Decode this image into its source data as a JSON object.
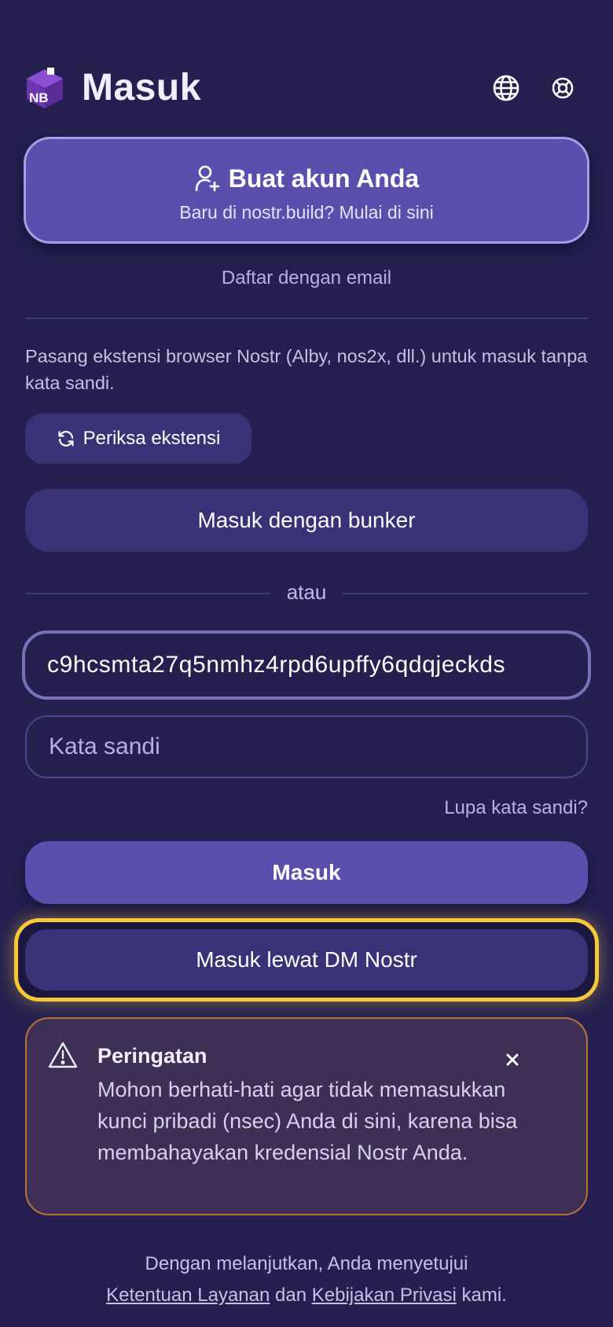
{
  "header": {
    "title": "Masuk",
    "logo_text": "NB",
    "globe_icon": "globe-icon",
    "help_icon": "lifebuoy-icon"
  },
  "create_account": {
    "title": "Buat akun Anda",
    "subtitle": "Baru di nostr.build? Mulai di sini",
    "icon": "user-plus-icon"
  },
  "email_signup": "Daftar dengan email",
  "extension": {
    "description": "Pasang ekstensi browser Nostr (Alby, nos2x, dll.) untuk masuk tanpa kata sandi.",
    "check_button": "Periksa ekstensi",
    "icon": "refresh-icon"
  },
  "bunker_button": "Masuk dengan bunker",
  "or_text": "atau",
  "key_field": {
    "value": "c9hcsmta27q5nmhz4rpd6upffy6qdqjeckds"
  },
  "password_field": {
    "placeholder": "Kata sandi"
  },
  "forgot_password": "Lupa kata sandi?",
  "login_button": "Masuk",
  "dm_login_button": "Masuk lewat DM Nostr",
  "warning": {
    "title": "Peringatan",
    "body": "Mohon berhati-hati agar tidak memasukkan kunci pribadi (nsec) Anda di sini, karena bisa membahayakan kredensial Nostr Anda.",
    "icon": "warning-triangle-icon",
    "close_icon": "close-icon"
  },
  "footer": {
    "prefix": "Dengan melanjutkan, Anda menyetujui",
    "terms": "Ketentuan Layanan",
    "and": "dan",
    "privacy": "Kebijakan Privasi",
    "suffix": "kami."
  },
  "colors": {
    "background": "#252050",
    "primary": "#5b4fae",
    "secondary": "#3a3277",
    "highlight": "#f5c838",
    "warning_border": "#b9733a"
  }
}
